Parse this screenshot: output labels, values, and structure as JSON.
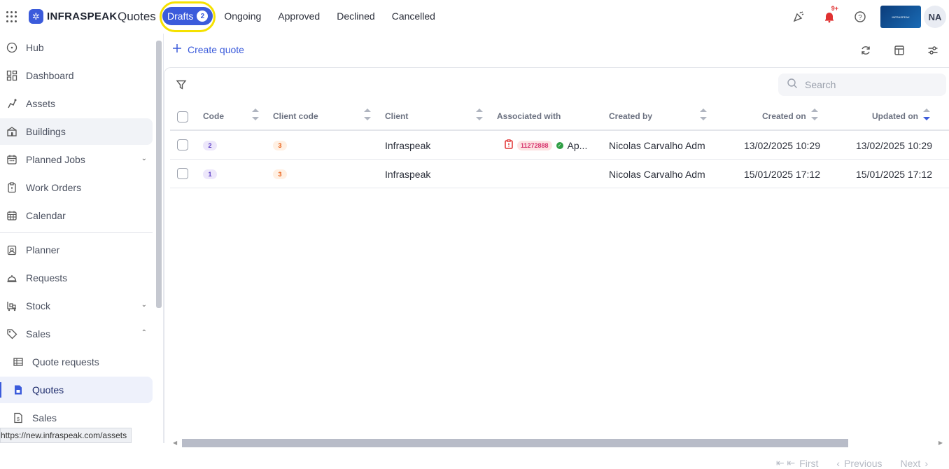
{
  "app": {
    "brand": "INFRASPEAK",
    "page_title": "Quotes",
    "status_url": "https://new.infraspeak.com/assets"
  },
  "tabs": [
    {
      "label": "Drafts",
      "count": "2",
      "active": true
    },
    {
      "label": "Ongoing"
    },
    {
      "label": "Approved"
    },
    {
      "label": "Declined"
    },
    {
      "label": "Cancelled"
    }
  ],
  "header_right": {
    "notification_badge": "9+",
    "avatar_initials": "NA",
    "brand_box_text": "INFRASPEAK"
  },
  "sidebar": {
    "items": [
      {
        "label": "Hub",
        "icon": "hub-icon"
      },
      {
        "label": "Dashboard",
        "icon": "dashboard-icon"
      },
      {
        "label": "Assets",
        "icon": "assets-icon"
      },
      {
        "label": "Buildings",
        "icon": "buildings-icon"
      },
      {
        "label": "Planned Jobs",
        "icon": "planned-jobs-icon"
      },
      {
        "label": "Work Orders",
        "icon": "work-orders-icon"
      },
      {
        "label": "Calendar",
        "icon": "calendar-icon"
      },
      {
        "label": "Planner",
        "icon": "planner-icon"
      },
      {
        "label": "Requests",
        "icon": "requests-icon"
      },
      {
        "label": "Stock",
        "icon": "stock-icon"
      },
      {
        "label": "Sales",
        "icon": "sales-icon"
      },
      {
        "label": "Quote requests",
        "icon": "quote-requests-icon"
      },
      {
        "label": "Quotes",
        "icon": "quotes-icon"
      },
      {
        "label": "Sales",
        "icon": "sales-doc-icon"
      }
    ]
  },
  "toolbar": {
    "create_label": "Create quote",
    "search_placeholder": "Search"
  },
  "table": {
    "columns": [
      "Code",
      "Client code",
      "Client",
      "Associated with",
      "Created by",
      "Created on",
      "Updated on"
    ],
    "rows": [
      {
        "code": "2",
        "client_code": "3",
        "client": "Infraspeak",
        "assoc_tag": "11272888",
        "assoc_status": "Ap...",
        "created_by": "Nicolas Carvalho Adm",
        "created_on": "13/02/2025 10:29",
        "updated_on": "13/02/2025 10:29"
      },
      {
        "code": "1",
        "client_code": "3",
        "client": "Infraspeak",
        "assoc_tag": "",
        "assoc_status": "",
        "created_by": "Nicolas Carvalho Adm",
        "created_on": "15/01/2025 17:12",
        "updated_on": "15/01/2025 17:12"
      }
    ]
  },
  "pager": {
    "first": "First",
    "previous": "Previous",
    "next": "Next"
  }
}
